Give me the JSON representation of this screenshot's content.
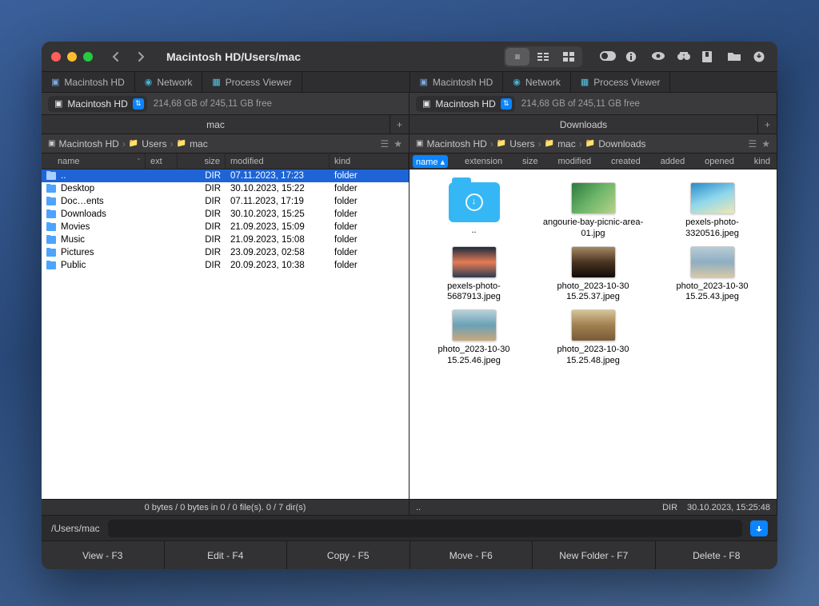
{
  "window": {
    "title": "Macintosh HD/Users/mac"
  },
  "view_modes": {
    "active": 0
  },
  "drive": {
    "name": "Macintosh HD",
    "free": "214,68 GB of 245,11 GB free"
  },
  "tabs": [
    {
      "label": "Macintosh HD",
      "icon": "drive"
    },
    {
      "label": "Network",
      "icon": "globe"
    },
    {
      "label": "Process Viewer",
      "icon": "app"
    }
  ],
  "left": {
    "folder_header": "mac",
    "breadcrumb": [
      "Macintosh HD",
      "Users",
      "mac"
    ],
    "columns": {
      "name": "name",
      "ext": "ext",
      "size": "size",
      "modified": "modified",
      "kind": "kind"
    },
    "rows": [
      {
        "name": "..",
        "ext": "",
        "size": "DIR",
        "modified": "07.11.2023, 17:23",
        "kind": "folder",
        "sel": true
      },
      {
        "name": "Desktop",
        "ext": "",
        "size": "DIR",
        "modified": "30.10.2023, 15:22",
        "kind": "folder"
      },
      {
        "name": "Doc…ents",
        "ext": "",
        "size": "DIR",
        "modified": "07.11.2023, 17:19",
        "kind": "folder"
      },
      {
        "name": "Downloads",
        "ext": "",
        "size": "DIR",
        "modified": "30.10.2023, 15:25",
        "kind": "folder"
      },
      {
        "name": "Movies",
        "ext": "",
        "size": "DIR",
        "modified": "21.09.2023, 15:09",
        "kind": "folder"
      },
      {
        "name": "Music",
        "ext": "",
        "size": "DIR",
        "modified": "21.09.2023, 15:08",
        "kind": "folder"
      },
      {
        "name": "Pictures",
        "ext": "",
        "size": "DIR",
        "modified": "23.09.2023, 02:58",
        "kind": "folder"
      },
      {
        "name": "Public",
        "ext": "",
        "size": "DIR",
        "modified": "20.09.2023, 10:38",
        "kind": "folder"
      }
    ],
    "status": "0 bytes / 0 bytes in 0 / 0 file(s). 0 / 7 dir(s)"
  },
  "right": {
    "folder_header": "Downloads",
    "breadcrumb": [
      "Macintosh HD",
      "Users",
      "mac",
      "Downloads"
    ],
    "columns": [
      "name",
      "extension",
      "size",
      "modified",
      "created",
      "added",
      "opened",
      "kind"
    ],
    "items": [
      {
        "label": "..",
        "kind": "parent"
      },
      {
        "label": "angourie-bay-picnic-area-01.jpg",
        "g": "g1"
      },
      {
        "label": "pexels-photo-3320516.jpeg",
        "g": "g2"
      },
      {
        "label": "pexels-photo-5687913.jpeg",
        "g": "g3"
      },
      {
        "label": "photo_2023-10-30 15.25.37.jpeg",
        "g": "g4"
      },
      {
        "label": "photo_2023-10-30 15.25.43.jpeg",
        "g": "g5"
      },
      {
        "label": "photo_2023-10-30 15.25.46.jpeg",
        "g": "g6"
      },
      {
        "label": "photo_2023-10-30 15.25.48.jpeg",
        "g": "g7"
      }
    ],
    "status_left": "..",
    "status_size": "DIR",
    "status_date": "30.10.2023, 15:25:48"
  },
  "cmd": {
    "path": "/Users/mac"
  },
  "fn": {
    "view": "View - F3",
    "edit": "Edit - F4",
    "copy": "Copy - F5",
    "move": "Move - F6",
    "newfolder": "New Folder - F7",
    "delete": "Delete - F8"
  }
}
